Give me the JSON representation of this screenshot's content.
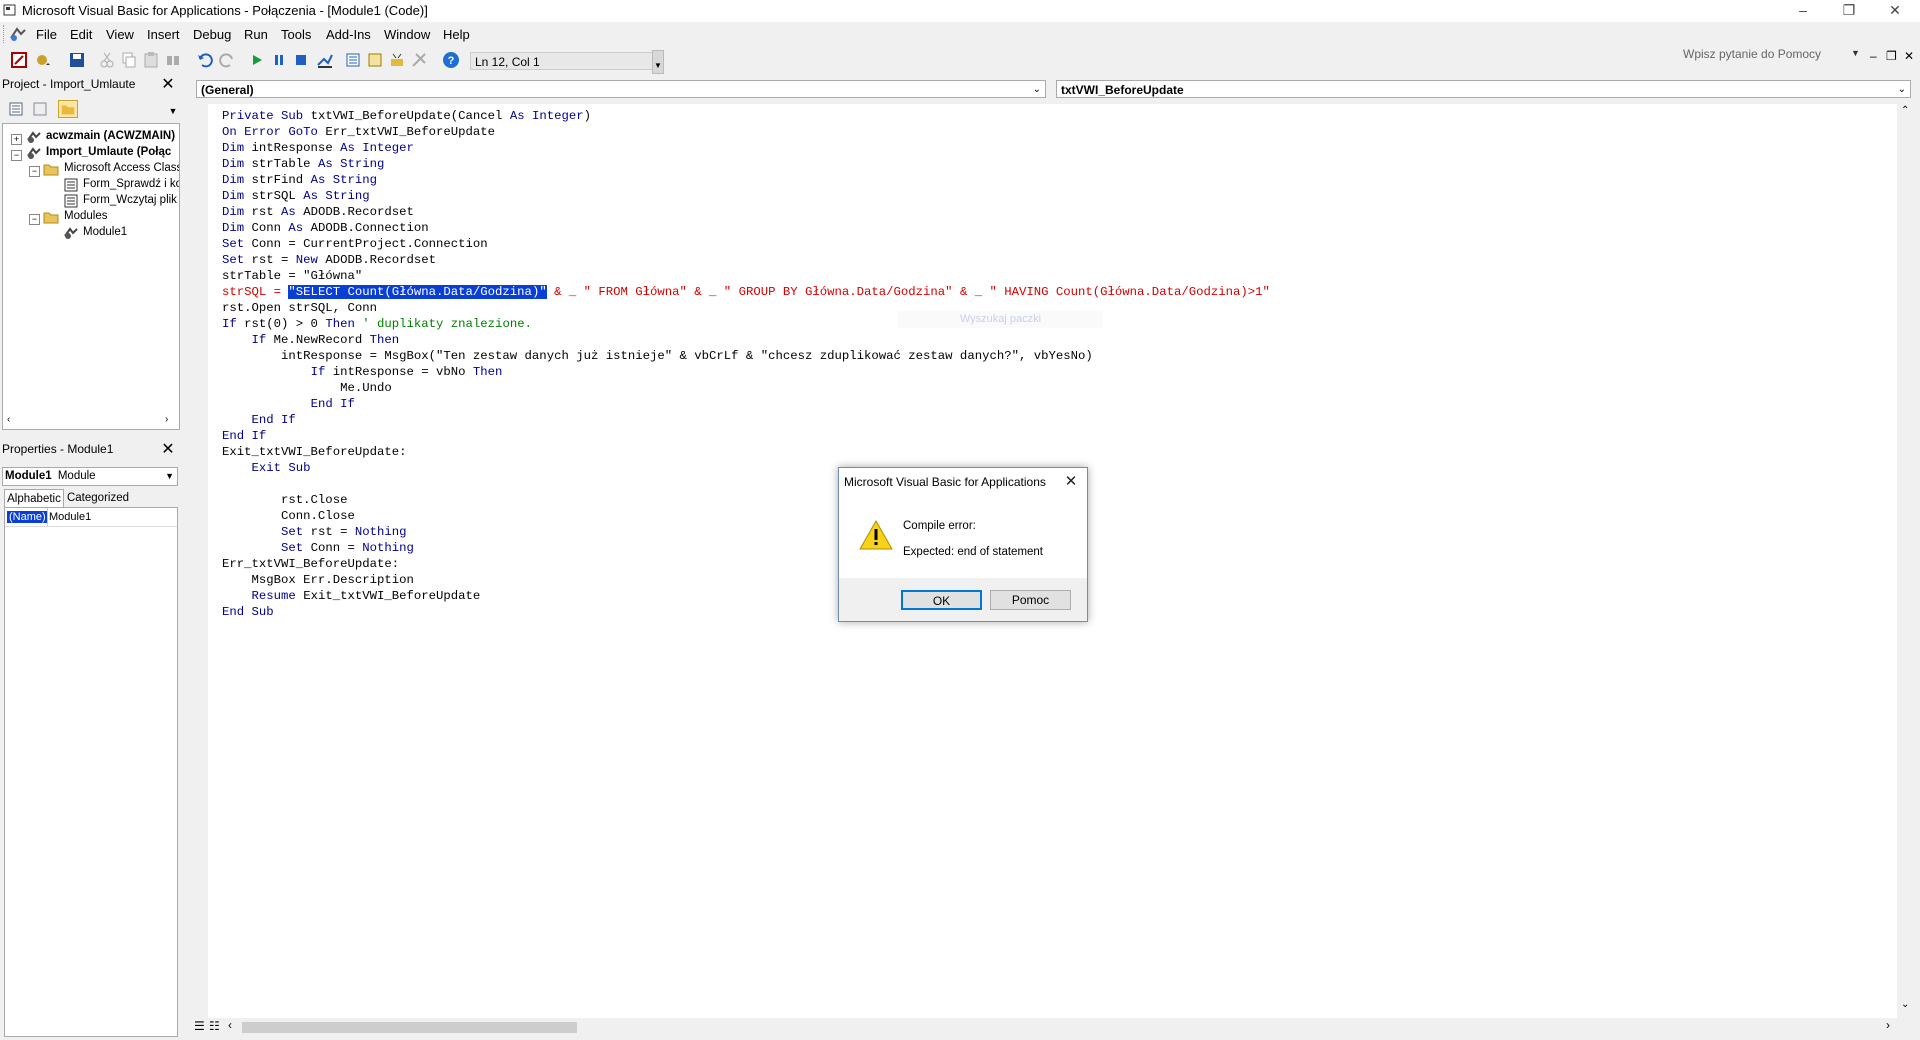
{
  "window": {
    "title": "Microsoft Visual Basic for Applications - Połączenia - [Module1 (Code)]",
    "controls": [
      "–",
      "❐",
      "✕"
    ]
  },
  "menu": {
    "items": [
      "File",
      "Edit",
      "View",
      "Insert",
      "Debug",
      "Run",
      "Tools",
      "Add-Ins",
      "Window",
      "Help"
    ],
    "help_search_placeholder": "Wpisz pytanie do Pomocy",
    "mdi_controls": [
      "–",
      "❐",
      "✕"
    ]
  },
  "toolbar": {
    "cursor_position": "Ln 12, Col 1"
  },
  "project_pane": {
    "title": "Project - Import_Umlaute",
    "tree": [
      {
        "label": "acwzmain (ACWZMAIN)",
        "bold": true
      },
      {
        "label": "Import_Umlaute (Połąc",
        "bold": true
      },
      {
        "label": "Microsoft Access Class (",
        "bold": false
      },
      {
        "label": "Form_Sprawdź i kop",
        "bold": false
      },
      {
        "label": "Form_Wczytaj plik",
        "bold": false
      },
      {
        "label": "Modules",
        "bold": false
      },
      {
        "label": "Module1",
        "bold": false
      }
    ]
  },
  "properties_pane": {
    "title": "Properties - Module1",
    "object_name": "Module1",
    "object_type": "Module",
    "tabs": [
      "Alphabetic",
      "Categorized"
    ],
    "rows": [
      {
        "name": "(Name)",
        "value": "Module1"
      }
    ]
  },
  "code_window": {
    "object_combo": "(General)",
    "procedure_combo": "txtVWI_BeforeUpdate",
    "ghost_text": "Wyszukaj paczki"
  },
  "dialog": {
    "title": "Microsoft Visual Basic for Applications",
    "line1": "Compile error:",
    "line2": "Expected: end of statement",
    "ok_label": "OK",
    "help_label": "Pomoc"
  },
  "code": [
    [
      {
        "t": "Private Sub",
        "c": "kw"
      },
      {
        "t": " txtVWI_BeforeUpdate(Cancel "
      },
      {
        "t": "As Integer",
        "c": "kw"
      },
      {
        "t": ")"
      }
    ],
    [
      {
        "t": "On Error GoTo",
        "c": "kw"
      },
      {
        "t": " Err_txtVWI_BeforeUpdate"
      }
    ],
    [
      {
        "t": "Dim",
        "c": "kw"
      },
      {
        "t": " intResponse "
      },
      {
        "t": "As Integer",
        "c": "kw"
      }
    ],
    [
      {
        "t": "Dim",
        "c": "kw"
      },
      {
        "t": " strTable "
      },
      {
        "t": "As String",
        "c": "kw"
      }
    ],
    [
      {
        "t": "Dim",
        "c": "kw"
      },
      {
        "t": " strFind "
      },
      {
        "t": "As String",
        "c": "kw"
      }
    ],
    [
      {
        "t": "Dim",
        "c": "kw"
      },
      {
        "t": " strSQL "
      },
      {
        "t": "As String",
        "c": "kw"
      }
    ],
    [
      {
        "t": "Dim",
        "c": "kw"
      },
      {
        "t": " rst "
      },
      {
        "t": "As",
        "c": "kw"
      },
      {
        "t": " ADODB.Recordset"
      }
    ],
    [
      {
        "t": "Dim",
        "c": "kw"
      },
      {
        "t": " Conn "
      },
      {
        "t": "As",
        "c": "kw"
      },
      {
        "t": " ADODB.Connection"
      }
    ],
    [
      {
        "t": "Set",
        "c": "kw"
      },
      {
        "t": " Conn = CurrentProject.Connection"
      }
    ],
    [
      {
        "t": "Set",
        "c": "kw"
      },
      {
        "t": " rst = "
      },
      {
        "t": "New",
        "c": "kw"
      },
      {
        "t": " ADODB.Recordset"
      }
    ],
    [
      {
        "t": "strTable = \"Główna\""
      }
    ],
    [
      {
        "t": "strSQL = ",
        "c": "err"
      },
      {
        "t": "\"SELECT Count(Główna.Data/Godzina)\"",
        "c": "sel"
      },
      {
        "t": " & _ \" FROM Główna\" & _ \" GROUP BY Główna.Data/Godzina\" & _ \" HAVING Count(Główna.Data/Godzina)>1\"",
        "c": "err"
      }
    ],
    [
      {
        "t": "rst.Open strSQL, Conn"
      }
    ],
    [
      {
        "t": "If",
        "c": "kw"
      },
      {
        "t": " rst(0) > 0 "
      },
      {
        "t": "Then",
        "c": "kw"
      },
      {
        "t": " ' duplikaty znalezione.",
        "c": "cmt"
      }
    ],
    [
      {
        "t": "    "
      },
      {
        "t": "If",
        "c": "kw"
      },
      {
        "t": " Me.NewRecord "
      },
      {
        "t": "Then",
        "c": "kw"
      }
    ],
    [
      {
        "t": "        intResponse = MsgBox(\"Ten zestaw danych już istnieje\" & vbCrLf & \"chcesz zduplikować zestaw danych?\", vbYesNo)"
      }
    ],
    [
      {
        "t": "            "
      },
      {
        "t": "If",
        "c": "kw"
      },
      {
        "t": " intResponse = vbNo "
      },
      {
        "t": "Then",
        "c": "kw"
      }
    ],
    [
      {
        "t": "                Me.Undo"
      }
    ],
    [
      {
        "t": "            "
      },
      {
        "t": "End If",
        "c": "kw"
      }
    ],
    [
      {
        "t": "    "
      },
      {
        "t": "End If",
        "c": "kw"
      }
    ],
    [
      {
        "t": "End If",
        "c": "kw"
      }
    ],
    [
      {
        "t": "Exit_txtVWI_BeforeUpdate:"
      }
    ],
    [
      {
        "t": "    "
      },
      {
        "t": "Exit Sub",
        "c": "kw"
      }
    ],
    [
      {
        "t": ""
      }
    ],
    [
      {
        "t": "        rst.Close"
      }
    ],
    [
      {
        "t": "        Conn.Close"
      }
    ],
    [
      {
        "t": "        "
      },
      {
        "t": "Set",
        "c": "kw"
      },
      {
        "t": " rst = "
      },
      {
        "t": "Nothing",
        "c": "kw"
      }
    ],
    [
      {
        "t": "        "
      },
      {
        "t": "Set",
        "c": "kw"
      },
      {
        "t": " Conn = "
      },
      {
        "t": "Nothing",
        "c": "kw"
      }
    ],
    [
      {
        "t": "Err_txtVWI_BeforeUpdate:"
      }
    ],
    [
      {
        "t": "    MsgBox Err.Description"
      }
    ],
    [
      {
        "t": "    "
      },
      {
        "t": "Resume",
        "c": "kw"
      },
      {
        "t": " Exit_txtVWI_BeforeUpdate"
      }
    ],
    [
      {
        "t": "End Sub",
        "c": "kw"
      }
    ]
  ]
}
